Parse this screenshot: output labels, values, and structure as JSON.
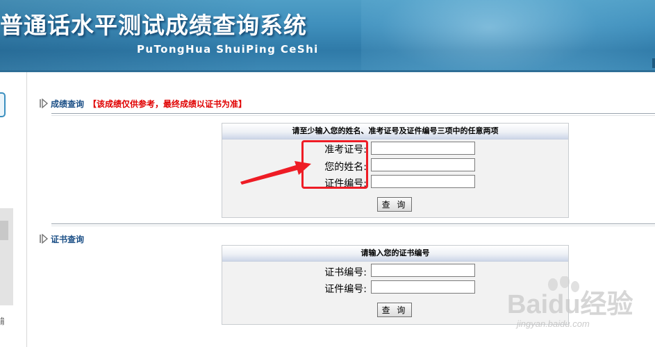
{
  "header": {
    "title": "普通话水平测试成绩查询系统",
    "subtitle": "PuTongHua ShuiPing CeShi"
  },
  "left_sidebar": {
    "partial_char": "能"
  },
  "score_query": {
    "heading": "成绩查询",
    "notice": "【该成绩仅供参考，最终成绩以证书为准】",
    "panel_title": "请至少输入您的姓名、准考证号及证件编号三项中的任意两项",
    "fields": [
      {
        "label": "准考证号:",
        "value": ""
      },
      {
        "label": "您的姓名:",
        "value": ""
      },
      {
        "label": "证件编号:",
        "value": ""
      }
    ],
    "button_label": "查 询"
  },
  "certificate_query": {
    "heading": "证书查询",
    "panel_title": "请输入您的证书编号",
    "fields": [
      {
        "label": "证书编号:",
        "value": ""
      },
      {
        "label": "证件编号:",
        "value": ""
      }
    ],
    "button_label": "查 询"
  },
  "annotation": {
    "highlight_color": "#ee1c25"
  },
  "watermark": {
    "brand": "Baidu经验",
    "url": "jingyan.baidu.com"
  },
  "colors": {
    "header_blue": "#3f8fbc",
    "heading_blue": "#1b4f86",
    "notice_red": "#e00000"
  }
}
